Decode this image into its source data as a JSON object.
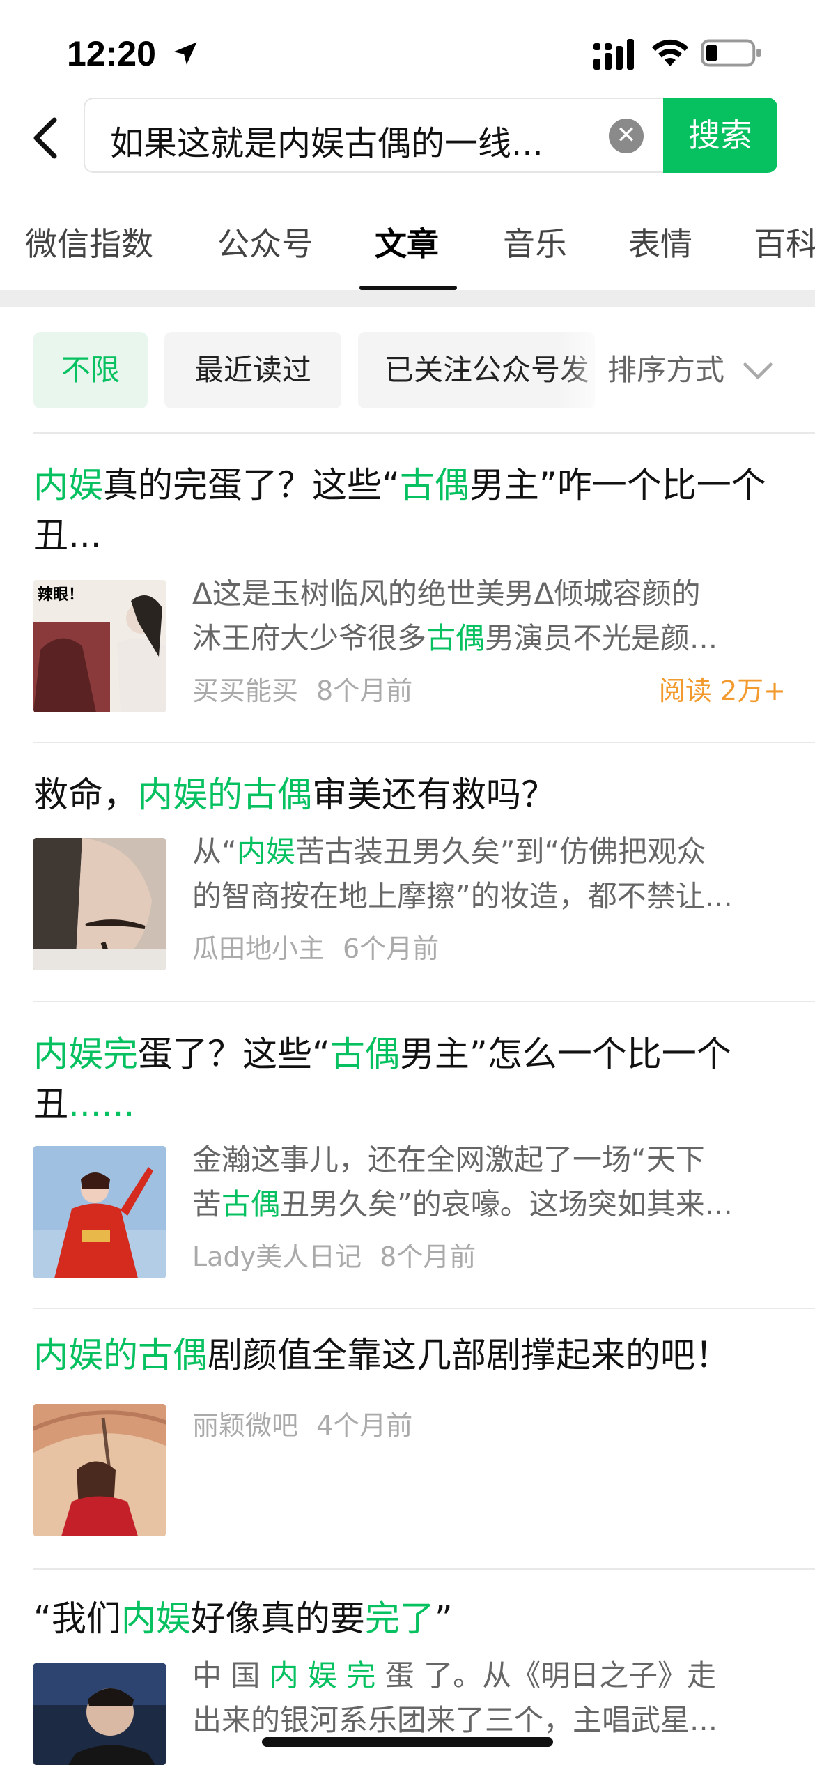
{
  "status_bar": {
    "time": "12:20"
  },
  "search": {
    "query": "如果这就是内娱古偶的一线...",
    "button_label": "搜索"
  },
  "tabs": [
    {
      "label": "微信指数"
    },
    {
      "label": "公众号"
    },
    {
      "label": "文章"
    },
    {
      "label": "音乐"
    },
    {
      "label": "表情"
    },
    {
      "label": "百科"
    }
  ],
  "active_tab": "文章",
  "filters": {
    "chips": [
      {
        "label": "不限"
      },
      {
        "label": "最近读过"
      },
      {
        "label": "已关注公众号发"
      }
    ],
    "sort_label": "排序方式"
  },
  "articles": [
    {
      "title_parts": [
        [
          "内娱",
          true
        ],
        [
          "真的完蛋了？这些“",
          false
        ],
        [
          "古偶",
          true
        ],
        [
          "男主”咋一个比一个丑...",
          false
        ]
      ],
      "desc_lines": [
        [
          [
            "Δ这是玉树临风的绝世美男Δ倾城容颜的",
            false
          ]
        ],
        [
          [
            "沐王府大少爷很多",
            false
          ],
          [
            "古偶",
            true
          ],
          [
            "男演员不光是颜...",
            false
          ]
        ]
      ],
      "source": "买买能买",
      "time": "8个月前",
      "reads": "阅读 2万+",
      "thumb_text": "辣眼！"
    },
    {
      "title_parts": [
        [
          "救命，",
          false
        ],
        [
          "内娱的古偶",
          true
        ],
        [
          "审美还有救吗？",
          false
        ]
      ],
      "desc_lines": [
        [
          [
            "从“",
            false
          ],
          [
            "内娱",
            true
          ],
          [
            "苦古装丑男久矣”到“仿佛把观众",
            false
          ]
        ],
        [
          [
            "的智商按在地上摩擦”的妆造，都不禁让...",
            false
          ]
        ]
      ],
      "source": "瓜田地小主",
      "time": "6个月前"
    },
    {
      "title_parts": [
        [
          "内娱完",
          true
        ],
        [
          "蛋了？这些“",
          false
        ],
        [
          "古偶",
          true
        ],
        [
          "男主”怎么一个比一个丑",
          false
        ],
        [
          "......",
          true
        ]
      ],
      "desc_lines": [
        [
          [
            "金瀚这事儿，还在全网激起了一场“天下",
            false
          ]
        ],
        [
          [
            "苦",
            false
          ],
          [
            "古偶",
            true
          ],
          [
            "丑男久矣”的哀嚎。这场突如其来...",
            false
          ]
        ]
      ],
      "source": "Lady美人日记",
      "time": "8个月前"
    },
    {
      "title_parts": [
        [
          "内娱的古偶",
          true
        ],
        [
          "剧颜值全靠这几部剧撑起来的吧！",
          false
        ]
      ],
      "desc_lines": [],
      "source": "丽颖微吧",
      "time": "4个月前"
    },
    {
      "title_parts": [
        [
          "“我们",
          false
        ],
        [
          "内娱",
          true
        ],
        [
          "好像真的要",
          false
        ],
        [
          "完了",
          true
        ],
        [
          "”",
          false
        ]
      ],
      "desc_lines": [
        [
          [
            "中 国 ",
            false
          ],
          [
            "内 娱 完",
            true
          ],
          [
            " 蛋 了。从《明日之子》走",
            false
          ]
        ],
        [
          [
            "出来的银河系乐团来了三个，主唱武星...",
            false
          ]
        ]
      ]
    }
  ],
  "colors": {
    "accent": "#07c160",
    "reads": "#f29a2e"
  }
}
